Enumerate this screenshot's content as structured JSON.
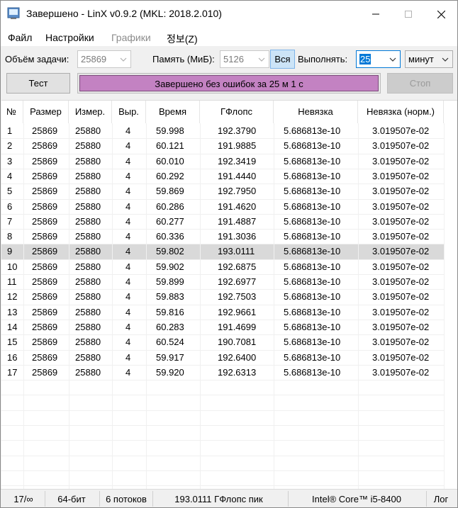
{
  "window": {
    "title": "Завершено - LinX v0.9.2 (MKL: 2018.2.010)",
    "controls": {
      "minimize": "—",
      "maximize": "☐",
      "close": "✕"
    }
  },
  "menu": {
    "file": "Файл",
    "settings": "Настройки",
    "graphs": "Графики",
    "about": "정보(Z)"
  },
  "toolbar": {
    "problem_size_label": "Объём задачи:",
    "problem_size_value": "25869",
    "memory_label": "Память (МиБ):",
    "memory_value": "5126",
    "all_button": "Вся",
    "run_label": "Выполнять:",
    "run_value": "25",
    "unit_value": "минут",
    "test_button": "Тест",
    "stop_button": "Стоп",
    "status_text": "Завершено без ошибок за 25 м 1 с",
    "progress_fraction": 1.0
  },
  "table": {
    "columns": [
      "№",
      "Размер",
      "Измер.",
      "Выр.",
      "Время",
      "ГФлопс",
      "Невязка",
      "Невязка (норм.)"
    ],
    "selected_row": 8,
    "rows": [
      [
        "1",
        "25869",
        "25880",
        "4",
        "59.998",
        "192.3790",
        "5.686813e-10",
        "3.019507e-02"
      ],
      [
        "2",
        "25869",
        "25880",
        "4",
        "60.121",
        "191.9885",
        "5.686813e-10",
        "3.019507e-02"
      ],
      [
        "3",
        "25869",
        "25880",
        "4",
        "60.010",
        "192.3419",
        "5.686813e-10",
        "3.019507e-02"
      ],
      [
        "4",
        "25869",
        "25880",
        "4",
        "60.292",
        "191.4440",
        "5.686813e-10",
        "3.019507e-02"
      ],
      [
        "5",
        "25869",
        "25880",
        "4",
        "59.869",
        "192.7950",
        "5.686813e-10",
        "3.019507e-02"
      ],
      [
        "6",
        "25869",
        "25880",
        "4",
        "60.286",
        "191.4620",
        "5.686813e-10",
        "3.019507e-02"
      ],
      [
        "7",
        "25869",
        "25880",
        "4",
        "60.277",
        "191.4887",
        "5.686813e-10",
        "3.019507e-02"
      ],
      [
        "8",
        "25869",
        "25880",
        "4",
        "60.336",
        "191.3036",
        "5.686813e-10",
        "3.019507e-02"
      ],
      [
        "9",
        "25869",
        "25880",
        "4",
        "59.802",
        "193.0111",
        "5.686813e-10",
        "3.019507e-02"
      ],
      [
        "10",
        "25869",
        "25880",
        "4",
        "59.902",
        "192.6875",
        "5.686813e-10",
        "3.019507e-02"
      ],
      [
        "11",
        "25869",
        "25880",
        "4",
        "59.899",
        "192.6977",
        "5.686813e-10",
        "3.019507e-02"
      ],
      [
        "12",
        "25869",
        "25880",
        "4",
        "59.883",
        "192.7503",
        "5.686813e-10",
        "3.019507e-02"
      ],
      [
        "13",
        "25869",
        "25880",
        "4",
        "59.816",
        "192.9661",
        "5.686813e-10",
        "3.019507e-02"
      ],
      [
        "14",
        "25869",
        "25880",
        "4",
        "60.283",
        "191.4699",
        "5.686813e-10",
        "3.019507e-02"
      ],
      [
        "15",
        "25869",
        "25880",
        "4",
        "60.524",
        "190.7081",
        "5.686813e-10",
        "3.019507e-02"
      ],
      [
        "16",
        "25869",
        "25880",
        "4",
        "59.917",
        "192.6400",
        "5.686813e-10",
        "3.019507e-02"
      ],
      [
        "17",
        "25869",
        "25880",
        "4",
        "59.920",
        "192.6313",
        "5.686813e-10",
        "3.019507e-02"
      ]
    ]
  },
  "statusbar": {
    "runs": "17/∞",
    "bitness": "64-бит",
    "threads": "6 потоков",
    "peak": "193.0111 ГФлопс пик",
    "cpu": "Intel® Core™ i5-8400",
    "log": "Лог"
  },
  "colors": {
    "progress_fill": "#c382c2",
    "selection": "#0078d7",
    "selected_row": "#d9d9d9"
  }
}
